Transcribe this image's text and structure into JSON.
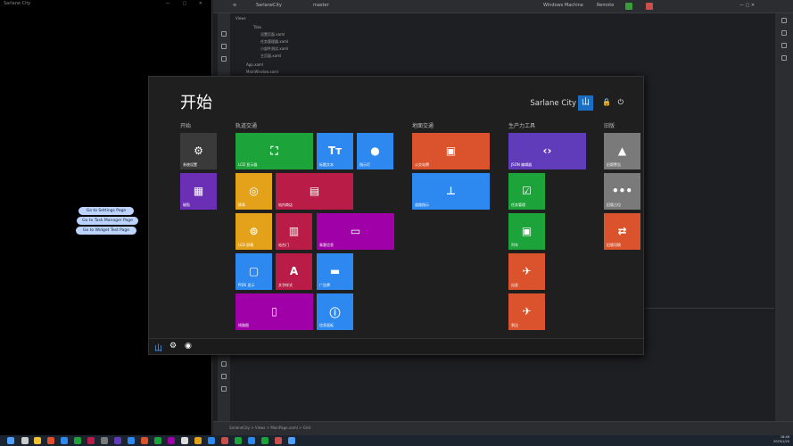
{
  "left_app": {
    "title": "Sarlane City",
    "buttons": [
      "Go to Settings Page",
      "Go to Task Manager Page",
      "Go to Widget Test Page"
    ]
  },
  "ide": {
    "project": "SarlaneCity",
    "branch": "master",
    "tab": "Remote",
    "run_config": "Windows Machine",
    "tree": [
      "Views",
      "Tiles",
      "设置页面.xaml",
      "任务管理器.xaml",
      "小部件测试.xaml",
      "主页面.xaml",
      "App.xaml",
      "MainWindow.xaml"
    ],
    "status": "SarlaneCity > Views > MainPage.xaml > Grid"
  },
  "start_menu": {
    "title": "开始",
    "user_name": "Sarlane City",
    "avatar_char": "山",
    "lock_char": "🔒",
    "power_char": "⏻",
    "groups": [
      {
        "label": "开始",
        "id": "g1"
      },
      {
        "label": "轨道交通",
        "id": "g2"
      },
      {
        "label": "地面交通",
        "id": "g3"
      },
      {
        "label": "生产力工具",
        "id": "g4"
      },
      {
        "label": "旧版",
        "id": "g5"
      }
    ],
    "tiles": [
      {
        "id": "settings",
        "label": "系统设置",
        "icon": "⚙",
        "color": "#3a3a3a"
      },
      {
        "id": "tiles",
        "label": "磁贴",
        "icon": "▦",
        "color": "#6b2fb5"
      },
      {
        "id": "lcd",
        "label": "LCD 显示器",
        "icon": "⛶",
        "color": "#1ca33a"
      },
      {
        "id": "tt",
        "label": "标题文本",
        "icon": "Tт",
        "color": "#2d89ef"
      },
      {
        "id": "circle",
        "label": "指示灯",
        "icon": "●",
        "color": "#2d89ef"
      },
      {
        "id": "rings",
        "label": "换乘",
        "icon": "◎",
        "color": "#e3a21a"
      },
      {
        "id": "shop",
        "label": "站内商店",
        "icon": "▤",
        "color": "#b91d47"
      },
      {
        "id": "led",
        "label": "LED 屏幕",
        "icon": "⊚",
        "color": "#e3a21a"
      },
      {
        "id": "bars",
        "label": "站台门",
        "icon": "▥",
        "color": "#b91d47"
      },
      {
        "id": "split",
        "label": "乘客信息",
        "icon": "▭",
        "color": "#9f00a7"
      },
      {
        "id": "pids",
        "label": "PIDS 显示",
        "icon": "▢",
        "color": "#2d89ef"
      },
      {
        "id": "font",
        "label": "文字样式",
        "icon": "A",
        "color": "#b91d47"
      },
      {
        "id": "ad",
        "label": "广告牌",
        "icon": "▬",
        "color": "#2d89ef"
      },
      {
        "id": "map",
        "label": "线路图",
        "icon": "▯",
        "color": "#9f00a7"
      },
      {
        "id": "info",
        "label": "信息面板",
        "icon": "ⓘ",
        "color": "#2d89ef"
      },
      {
        "id": "bus",
        "label": "公交站牌",
        "icon": "▣",
        "color": "#da532c"
      },
      {
        "id": "sign",
        "label": "道路指示",
        "icon": "⊥",
        "color": "#2d89ef"
      },
      {
        "id": "json",
        "label": "JSON 编辑器",
        "icon": "‹›",
        "color": "#603cba"
      },
      {
        "id": "tasks",
        "label": "任务管理",
        "icon": "☑",
        "color": "#1ca33a"
      },
      {
        "id": "train",
        "label": "列车",
        "icon": "▣",
        "color": "#1ca33a"
      },
      {
        "id": "depart",
        "label": "出发",
        "icon": "✈",
        "color": "#da532c"
      },
      {
        "id": "arrive",
        "label": "到达",
        "icon": "✈",
        "color": "#da532c"
      },
      {
        "id": "warn",
        "label": "旧版警告",
        "icon": "▲",
        "color": "#7a7a7a"
      },
      {
        "id": "dots",
        "label": "旧版占位",
        "icon": "•••",
        "color": "#7a7a7a"
      },
      {
        "id": "swap",
        "label": "旧版切换",
        "icon": "⇄",
        "color": "#da532c"
      }
    ],
    "bottom": {
      "logo": "山",
      "settings": "⚙",
      "power": "◉"
    }
  },
  "taskbar": {
    "time": "18:46",
    "date": "2025/1/20"
  }
}
